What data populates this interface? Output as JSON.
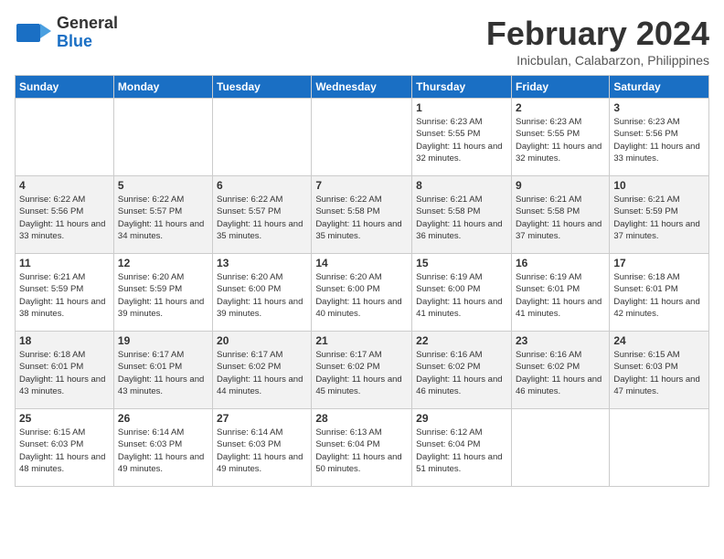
{
  "header": {
    "logo_line1": "General",
    "logo_line2": "Blue",
    "month": "February 2024",
    "location": "Inicbulan, Calabarzon, Philippines"
  },
  "days_of_week": [
    "Sunday",
    "Monday",
    "Tuesday",
    "Wednesday",
    "Thursday",
    "Friday",
    "Saturday"
  ],
  "weeks": [
    [
      {
        "day": "",
        "sunrise": "",
        "sunset": "",
        "daylight": ""
      },
      {
        "day": "",
        "sunrise": "",
        "sunset": "",
        "daylight": ""
      },
      {
        "day": "",
        "sunrise": "",
        "sunset": "",
        "daylight": ""
      },
      {
        "day": "",
        "sunrise": "",
        "sunset": "",
        "daylight": ""
      },
      {
        "day": "1",
        "sunrise": "Sunrise: 6:23 AM",
        "sunset": "Sunset: 5:55 PM",
        "daylight": "Daylight: 11 hours and 32 minutes."
      },
      {
        "day": "2",
        "sunrise": "Sunrise: 6:23 AM",
        "sunset": "Sunset: 5:55 PM",
        "daylight": "Daylight: 11 hours and 32 minutes."
      },
      {
        "day": "3",
        "sunrise": "Sunrise: 6:23 AM",
        "sunset": "Sunset: 5:56 PM",
        "daylight": "Daylight: 11 hours and 33 minutes."
      }
    ],
    [
      {
        "day": "4",
        "sunrise": "Sunrise: 6:22 AM",
        "sunset": "Sunset: 5:56 PM",
        "daylight": "Daylight: 11 hours and 33 minutes."
      },
      {
        "day": "5",
        "sunrise": "Sunrise: 6:22 AM",
        "sunset": "Sunset: 5:57 PM",
        "daylight": "Daylight: 11 hours and 34 minutes."
      },
      {
        "day": "6",
        "sunrise": "Sunrise: 6:22 AM",
        "sunset": "Sunset: 5:57 PM",
        "daylight": "Daylight: 11 hours and 35 minutes."
      },
      {
        "day": "7",
        "sunrise": "Sunrise: 6:22 AM",
        "sunset": "Sunset: 5:58 PM",
        "daylight": "Daylight: 11 hours and 35 minutes."
      },
      {
        "day": "8",
        "sunrise": "Sunrise: 6:21 AM",
        "sunset": "Sunset: 5:58 PM",
        "daylight": "Daylight: 11 hours and 36 minutes."
      },
      {
        "day": "9",
        "sunrise": "Sunrise: 6:21 AM",
        "sunset": "Sunset: 5:58 PM",
        "daylight": "Daylight: 11 hours and 37 minutes."
      },
      {
        "day": "10",
        "sunrise": "Sunrise: 6:21 AM",
        "sunset": "Sunset: 5:59 PM",
        "daylight": "Daylight: 11 hours and 37 minutes."
      }
    ],
    [
      {
        "day": "11",
        "sunrise": "Sunrise: 6:21 AM",
        "sunset": "Sunset: 5:59 PM",
        "daylight": "Daylight: 11 hours and 38 minutes."
      },
      {
        "day": "12",
        "sunrise": "Sunrise: 6:20 AM",
        "sunset": "Sunset: 5:59 PM",
        "daylight": "Daylight: 11 hours and 39 minutes."
      },
      {
        "day": "13",
        "sunrise": "Sunrise: 6:20 AM",
        "sunset": "Sunset: 6:00 PM",
        "daylight": "Daylight: 11 hours and 39 minutes."
      },
      {
        "day": "14",
        "sunrise": "Sunrise: 6:20 AM",
        "sunset": "Sunset: 6:00 PM",
        "daylight": "Daylight: 11 hours and 40 minutes."
      },
      {
        "day": "15",
        "sunrise": "Sunrise: 6:19 AM",
        "sunset": "Sunset: 6:00 PM",
        "daylight": "Daylight: 11 hours and 41 minutes."
      },
      {
        "day": "16",
        "sunrise": "Sunrise: 6:19 AM",
        "sunset": "Sunset: 6:01 PM",
        "daylight": "Daylight: 11 hours and 41 minutes."
      },
      {
        "day": "17",
        "sunrise": "Sunrise: 6:18 AM",
        "sunset": "Sunset: 6:01 PM",
        "daylight": "Daylight: 11 hours and 42 minutes."
      }
    ],
    [
      {
        "day": "18",
        "sunrise": "Sunrise: 6:18 AM",
        "sunset": "Sunset: 6:01 PM",
        "daylight": "Daylight: 11 hours and 43 minutes."
      },
      {
        "day": "19",
        "sunrise": "Sunrise: 6:17 AM",
        "sunset": "Sunset: 6:01 PM",
        "daylight": "Daylight: 11 hours and 43 minutes."
      },
      {
        "day": "20",
        "sunrise": "Sunrise: 6:17 AM",
        "sunset": "Sunset: 6:02 PM",
        "daylight": "Daylight: 11 hours and 44 minutes."
      },
      {
        "day": "21",
        "sunrise": "Sunrise: 6:17 AM",
        "sunset": "Sunset: 6:02 PM",
        "daylight": "Daylight: 11 hours and 45 minutes."
      },
      {
        "day": "22",
        "sunrise": "Sunrise: 6:16 AM",
        "sunset": "Sunset: 6:02 PM",
        "daylight": "Daylight: 11 hours and 46 minutes."
      },
      {
        "day": "23",
        "sunrise": "Sunrise: 6:16 AM",
        "sunset": "Sunset: 6:02 PM",
        "daylight": "Daylight: 11 hours and 46 minutes."
      },
      {
        "day": "24",
        "sunrise": "Sunrise: 6:15 AM",
        "sunset": "Sunset: 6:03 PM",
        "daylight": "Daylight: 11 hours and 47 minutes."
      }
    ],
    [
      {
        "day": "25",
        "sunrise": "Sunrise: 6:15 AM",
        "sunset": "Sunset: 6:03 PM",
        "daylight": "Daylight: 11 hours and 48 minutes."
      },
      {
        "day": "26",
        "sunrise": "Sunrise: 6:14 AM",
        "sunset": "Sunset: 6:03 PM",
        "daylight": "Daylight: 11 hours and 49 minutes."
      },
      {
        "day": "27",
        "sunrise": "Sunrise: 6:14 AM",
        "sunset": "Sunset: 6:03 PM",
        "daylight": "Daylight: 11 hours and 49 minutes."
      },
      {
        "day": "28",
        "sunrise": "Sunrise: 6:13 AM",
        "sunset": "Sunset: 6:04 PM",
        "daylight": "Daylight: 11 hours and 50 minutes."
      },
      {
        "day": "29",
        "sunrise": "Sunrise: 6:12 AM",
        "sunset": "Sunset: 6:04 PM",
        "daylight": "Daylight: 11 hours and 51 minutes."
      },
      {
        "day": "",
        "sunrise": "",
        "sunset": "",
        "daylight": ""
      },
      {
        "day": "",
        "sunrise": "",
        "sunset": "",
        "daylight": ""
      }
    ]
  ]
}
